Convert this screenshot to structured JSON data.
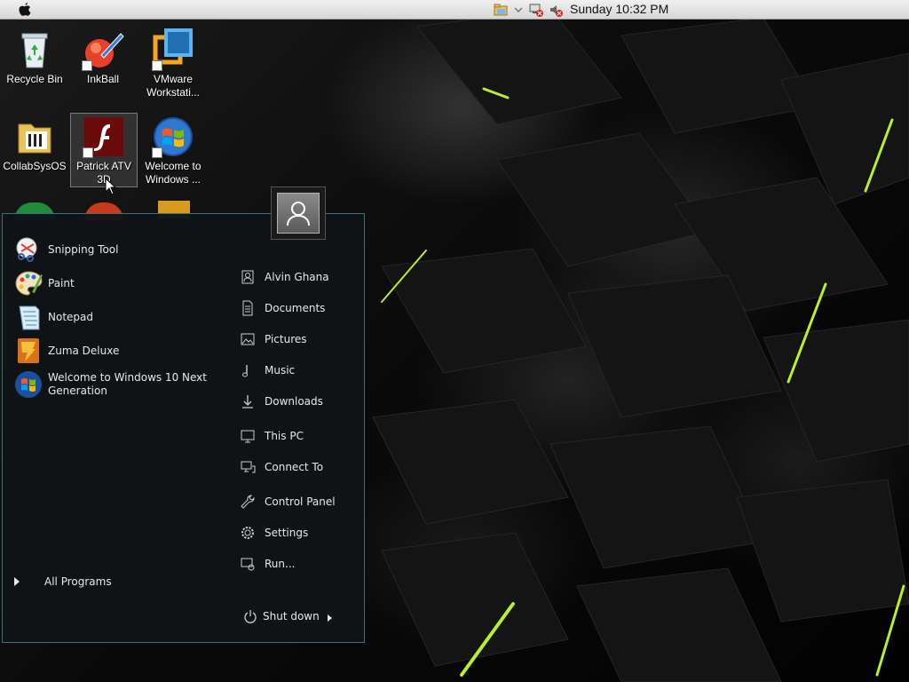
{
  "menubar": {
    "clock": "Sunday 10:32 PM"
  },
  "desktop": {
    "icons": [
      {
        "label": "Recycle Bin",
        "icon": "recycle-bin-icon"
      },
      {
        "label": "InkBall",
        "icon": "inkball-icon"
      },
      {
        "label": "VMware Workstati...",
        "icon": "vmware-icon"
      },
      {
        "label": "CollabSysOS",
        "icon": "folder-icon"
      },
      {
        "label": "Patrick ATV 3D",
        "icon": "flash-icon"
      },
      {
        "label": "Welcome to Windows ...",
        "icon": "windows-logo-icon"
      }
    ]
  },
  "start_menu": {
    "pinned": [
      {
        "label": "Snipping Tool",
        "icon": "snipping-tool-icon"
      },
      {
        "label": "Paint",
        "icon": "paint-icon"
      },
      {
        "label": "Notepad",
        "icon": "notepad-icon"
      },
      {
        "label": "Zuma Deluxe",
        "icon": "zuma-icon"
      },
      {
        "label": "Welcome to Windows 10 Next Generation",
        "icon": "windows-logo-icon"
      }
    ],
    "places": [
      {
        "label": "Alvin Ghana",
        "icon": "user-folder-icon"
      },
      {
        "label": "Documents",
        "icon": "document-icon"
      },
      {
        "label": "Pictures",
        "icon": "picture-icon"
      },
      {
        "label": "Music",
        "icon": "music-note-icon"
      },
      {
        "label": "Downloads",
        "icon": "download-arrow-icon"
      },
      {
        "label": "This PC",
        "icon": "computer-icon"
      },
      {
        "label": "Connect To",
        "icon": "network-icon"
      },
      {
        "label": "Control Panel",
        "icon": "wrench-icon"
      },
      {
        "label": "Settings",
        "icon": "gear-icon"
      },
      {
        "label": "Run...",
        "icon": "run-icon"
      }
    ],
    "all_programs": "All Programs",
    "shutdown": "Shut down"
  }
}
